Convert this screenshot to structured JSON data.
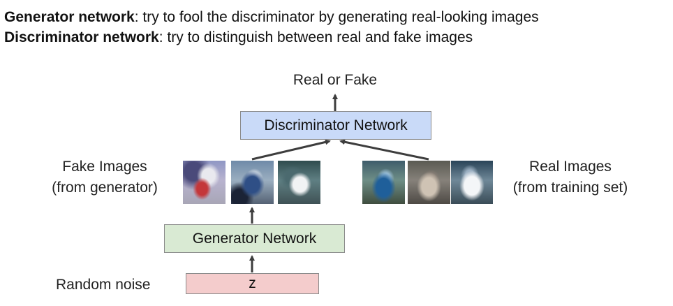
{
  "header": {
    "line1_bold": "Generator network",
    "line1_rest": ": try to fool the discriminator by generating real-looking images",
    "line2_bold": "Discriminator network",
    "line2_rest": ": try to distinguish between real and fake images"
  },
  "diagram": {
    "output_label": "Real or Fake",
    "discriminator_label": "Discriminator Network",
    "generator_label": "Generator Network",
    "noise_input_label": "z",
    "noise_caption": "Random noise",
    "fake_caption_line1": "Fake Images",
    "fake_caption_line2": "(from generator)",
    "real_caption_line1": "Real Images",
    "real_caption_line2": "(from training set)"
  },
  "colors": {
    "discriminator_fill": "#c9daf8",
    "generator_fill": "#d9ead3",
    "noise_fill": "#f4cccc",
    "arrow": "#3d3d3d"
  },
  "images": {
    "fake": [
      "fake-car-image-1",
      "fake-car-image-2",
      "fake-car-image-3"
    ],
    "real": [
      "real-car-image-1",
      "real-car-image-2",
      "real-car-image-3"
    ]
  }
}
